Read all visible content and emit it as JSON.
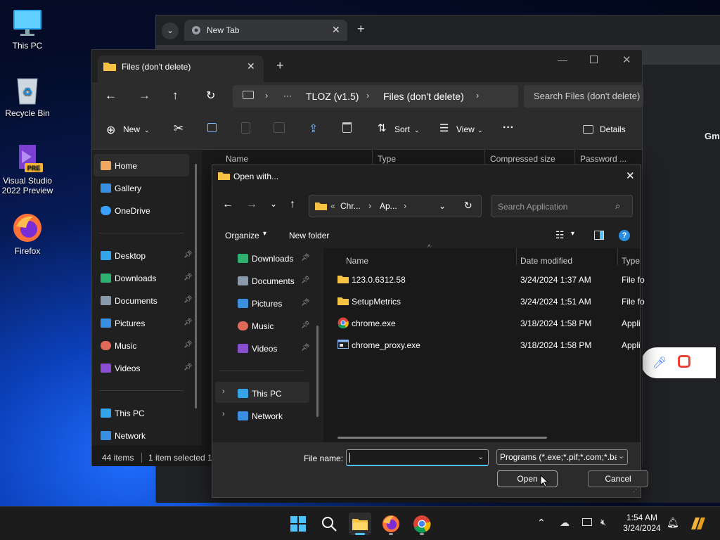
{
  "desktop": {
    "icons": [
      {
        "label": "This PC"
      },
      {
        "label": "Recycle Bin"
      },
      {
        "label": "Visual Studio 2022 Preview",
        "badge": "PRE"
      },
      {
        "label": "Firefox"
      }
    ]
  },
  "chrome": {
    "tab_title": "New Tab",
    "partial_text": "Gm"
  },
  "explorer": {
    "tab_title": "Files (don't delete)",
    "address": {
      "more": "···",
      "crumb1": "TLOZ (v1.5)",
      "crumb2": "Files (don't delete)"
    },
    "search_placeholder": "Search Files (don't delete)",
    "toolbar": {
      "new_label": "New",
      "sort_label": "Sort",
      "view_label": "View",
      "more_label": "···",
      "details_label": "Details"
    },
    "sidebar": {
      "home": "Home",
      "gallery": "Gallery",
      "onedrive": "OneDrive",
      "desktop": "Desktop",
      "downloads": "Downloads",
      "documents": "Documents",
      "pictures": "Pictures",
      "music": "Music",
      "videos": "Videos",
      "thispc": "This PC",
      "network": "Network"
    },
    "columns": {
      "name": "Name",
      "type": "Type",
      "compressed": "Compressed size",
      "password": "Password ..."
    },
    "status": {
      "items": "44 items",
      "selected": "1 item selected  1"
    }
  },
  "dialog": {
    "title": "Open with...",
    "address": {
      "prefix": "«",
      "crumb1": "Chr...",
      "crumb2": "Ap..."
    },
    "search_placeholder": "Search Application",
    "organize_label": "Organize",
    "new_folder_label": "New folder",
    "help_glyph": "?",
    "nav": {
      "downloads": "Downloads",
      "documents": "Documents",
      "pictures": "Pictures",
      "music": "Music",
      "videos": "Videos",
      "thispc": "This PC",
      "network": "Network"
    },
    "columns": {
      "name": "Name",
      "date": "Date modified",
      "type": "Type"
    },
    "files": [
      {
        "name": "123.0.6312.58",
        "date": "3/24/2024 1:37 AM",
        "type": "File fo",
        "icon": "folder-icon"
      },
      {
        "name": "SetupMetrics",
        "date": "3/24/2024 1:51 AM",
        "type": "File fo",
        "icon": "folder-icon"
      },
      {
        "name": "chrome.exe",
        "date": "3/18/2024 1:58 PM",
        "type": "Appli",
        "icon": "chrome-icon"
      },
      {
        "name": "chrome_proxy.exe",
        "date": "3/18/2024 1:58 PM",
        "type": "Appli",
        "icon": "exe-icon"
      }
    ],
    "file_name_label": "File name:",
    "file_name_value": "",
    "filter_value": "Programs (*.exe;*.pif;*.com;*.ba",
    "open_label": "Open",
    "cancel_label": "Cancel"
  },
  "taskbar": {
    "time": "1:54 AM",
    "date": "3/24/2024"
  },
  "colors": {
    "accent": "#4cc2ff",
    "folder": "#f6c244",
    "selection": "#2d2d2d"
  }
}
